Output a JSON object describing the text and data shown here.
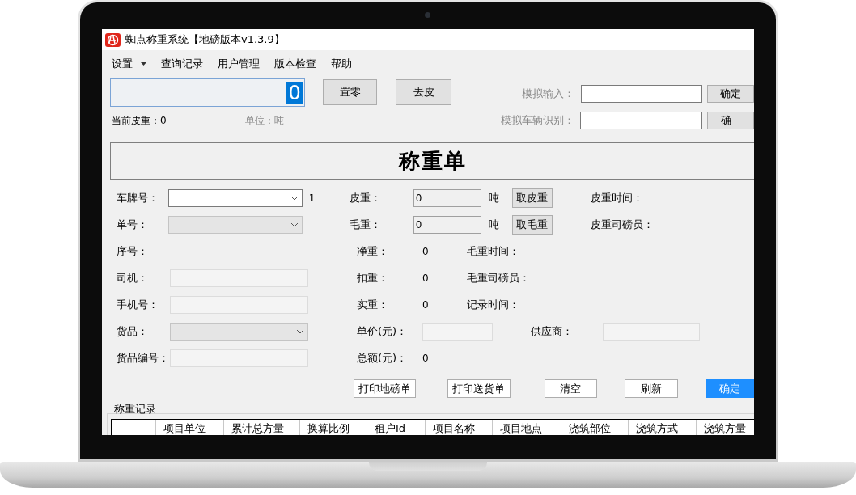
{
  "window": {
    "title": "蜘点称重系统【地磅版本v1.3.9】"
  },
  "menu": [
    {
      "label": "设置",
      "kind": "dropdown"
    },
    {
      "label": "查询记录",
      "kind": "item"
    },
    {
      "label": "用户管理",
      "kind": "item"
    },
    {
      "label": "版本检查",
      "kind": "item"
    },
    {
      "label": "帮助",
      "kind": "item"
    }
  ],
  "weight_display": {
    "value": "0",
    "selected": true
  },
  "top_buttons": [
    "置零",
    "去皮"
  ],
  "current_tare": {
    "label": "当前皮重：",
    "value": "0"
  },
  "unit_label": "单位：吨",
  "simulate": [
    {
      "label": "模拟输入：",
      "button": "确定"
    },
    {
      "label": "模拟车辆识别：",
      "button": "确"
    }
  ],
  "form_title": "称重单",
  "left_fields": [
    {
      "label": "车牌号：",
      "kind": "combo",
      "disabled": false,
      "note": "1"
    },
    {
      "label": "单号：",
      "kind": "combo",
      "disabled": true
    },
    {
      "label": "序号：",
      "kind": "none"
    },
    {
      "label": "司机：",
      "kind": "text",
      "disabled": true
    },
    {
      "label": "手机号：",
      "kind": "text",
      "disabled": true
    },
    {
      "label": "货品：",
      "kind": "combo",
      "disabled": true
    },
    {
      "label": "货品编号：",
      "kind": "text",
      "disabled": true
    }
  ],
  "middle_fields": [
    {
      "label": "皮重：",
      "kind": "input",
      "value": "0",
      "unit": "吨",
      "button": "取皮重"
    },
    {
      "label": "毛重：",
      "kind": "input",
      "value": "0",
      "unit": "吨",
      "button": "取毛重"
    },
    {
      "label": "净重：",
      "kind": "value",
      "value": "0"
    },
    {
      "label": "扣重：",
      "kind": "value",
      "value": "0"
    },
    {
      "label": "实重：",
      "kind": "value",
      "value": "0"
    },
    {
      "label": "单价(元)：",
      "kind": "text",
      "disabled": true
    },
    {
      "label": "总额(元)：",
      "kind": "value",
      "value": "0"
    }
  ],
  "right_fields": [
    {
      "label": "皮重时间：",
      "kind": "none"
    },
    {
      "label": "皮重司磅员：",
      "kind": "none"
    },
    {
      "label": "毛重时间：",
      "kind": "none"
    },
    {
      "label": "毛重司磅员：",
      "kind": "none"
    },
    {
      "label": "记录时间：",
      "kind": "none"
    },
    {
      "label": "供应商：",
      "kind": "text",
      "disabled": true
    }
  ],
  "action_buttons": [
    {
      "label": "打印地磅单",
      "primary": false
    },
    {
      "label": "打印送货单",
      "primary": false
    },
    {
      "label": "清空",
      "primary": false
    },
    {
      "label": "刷新",
      "primary": false
    },
    {
      "label": "确定",
      "primary": true
    }
  ],
  "records": {
    "title": "称重记录",
    "columns": [
      "项目单位",
      "累计总方量",
      "换算比例",
      "租户Id",
      "项目名称",
      "项目地点",
      "浇筑部位",
      "浇筑方式",
      "浇筑方量"
    ]
  }
}
